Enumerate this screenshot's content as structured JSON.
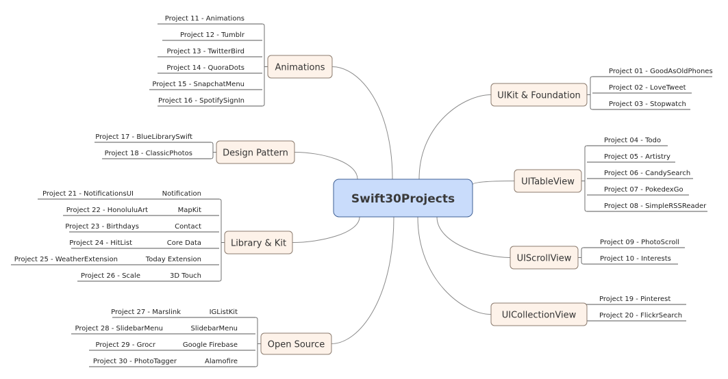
{
  "root": {
    "label": "Swift30Projects",
    "fill": "#c9dcfb",
    "stroke": "#3e5f94"
  },
  "topic_style": {
    "fill": "#fdf2e9",
    "stroke": "#8b7b6e"
  },
  "topics": [
    {
      "label": "Animations",
      "side": "left",
      "items": [
        {
          "project": "Project 11 - Animations"
        },
        {
          "project": "Project 12 - Tumblr"
        },
        {
          "project": "Project 13 - TwitterBird"
        },
        {
          "project": "Project 14 - QuoraDots"
        },
        {
          "project": "Project 15 - SnapchatMenu"
        },
        {
          "project": "Project 16 - SpotifySignIn"
        }
      ]
    },
    {
      "label": "Design Pattern",
      "side": "left",
      "items": [
        {
          "project": "Project 17 - BlueLibrarySwift"
        },
        {
          "project": "Project 18 - ClassicPhotos"
        }
      ]
    },
    {
      "label": "Library & Kit",
      "side": "left",
      "items": [
        {
          "project": "Project 21 - NotificationsUI",
          "tag": "Notification"
        },
        {
          "project": "Project 22 - HonoluluArt",
          "tag": "MapKit"
        },
        {
          "project": "Project 23 - Birthdays",
          "tag": "Contact"
        },
        {
          "project": "Project 24 - HitList",
          "tag": "Core Data"
        },
        {
          "project": "Project 25 - WeatherExtension",
          "tag": "Today Extension"
        },
        {
          "project": "Project 26 - Scale",
          "tag": "3D Touch"
        }
      ]
    },
    {
      "label": "Open Source",
      "side": "left",
      "items": [
        {
          "project": "Project 27 - Marslink",
          "tag": "IGListKit"
        },
        {
          "project": "Project 28 - SlidebarMenu",
          "tag": "SlidebarMenu"
        },
        {
          "project": "Project 29 - Grocr",
          "tag": "Google Firebase"
        },
        {
          "project": "Project 30 - PhotoTagger",
          "tag": "Alamofire"
        }
      ]
    },
    {
      "label": "UIKit & Foundation",
      "side": "right",
      "items": [
        {
          "project": "Project 01 - GoodAsOldPhones"
        },
        {
          "project": "Project 02 - LoveTweet"
        },
        {
          "project": "Project 03 - Stopwatch"
        }
      ]
    },
    {
      "label": "UITableView",
      "side": "right",
      "items": [
        {
          "project": "Project 04 - Todo"
        },
        {
          "project": "Project 05 - Artistry"
        },
        {
          "project": "Project 06 - CandySearch"
        },
        {
          "project": "Project 07 - PokedexGo"
        },
        {
          "project": "Project 08 - SimpleRSSReader"
        }
      ]
    },
    {
      "label": "UIScrollView",
      "side": "right",
      "items": [
        {
          "project": "Project 09 - PhotoScroll"
        },
        {
          "project": "Project 10 - Interests"
        }
      ]
    },
    {
      "label": "UICollectionView",
      "side": "right",
      "items": [
        {
          "project": "Project 19 - Pinterest"
        },
        {
          "project": "Project 20 - FlickrSearch"
        }
      ]
    }
  ]
}
